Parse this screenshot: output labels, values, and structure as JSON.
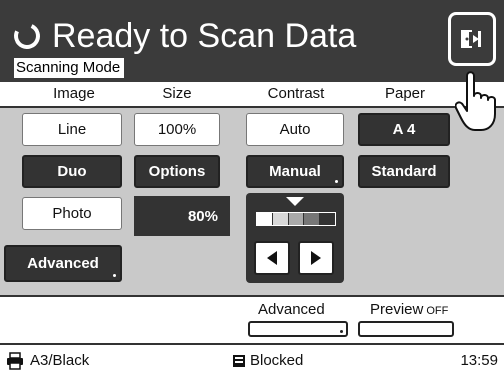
{
  "header": {
    "title": "Ready to Scan Data",
    "mode_label": "Scanning Mode",
    "exit_icon": "exit-door-icon",
    "status_icon": "scanning-spinner-icon"
  },
  "columns": {
    "image": "Image",
    "size": "Size",
    "contrast": "Contrast",
    "paper": "Paper"
  },
  "image_options": {
    "line": "Line",
    "duo": "Duo",
    "photo": "Photo",
    "advanced": "Advanced"
  },
  "size_options": {
    "percent": "100%",
    "options": "Options",
    "current_value": "80%"
  },
  "contrast_options": {
    "auto": "Auto",
    "manual": "Manual",
    "left_arrow_icon": "left-arrow-icon",
    "right_arrow_icon": "right-arrow-icon"
  },
  "paper_options": {
    "a4": "A 4",
    "standard": "Standard"
  },
  "actions": {
    "advanced": "Advanced",
    "preview": "Preview",
    "preview_state": "OFF"
  },
  "status": {
    "paper": "A3/Black",
    "lock_state": "Blocked",
    "time": "13:59"
  },
  "colors": {
    "dark": "#333333",
    "panel_gray": "#c9c9c9",
    "header": "#3b3b3b"
  }
}
